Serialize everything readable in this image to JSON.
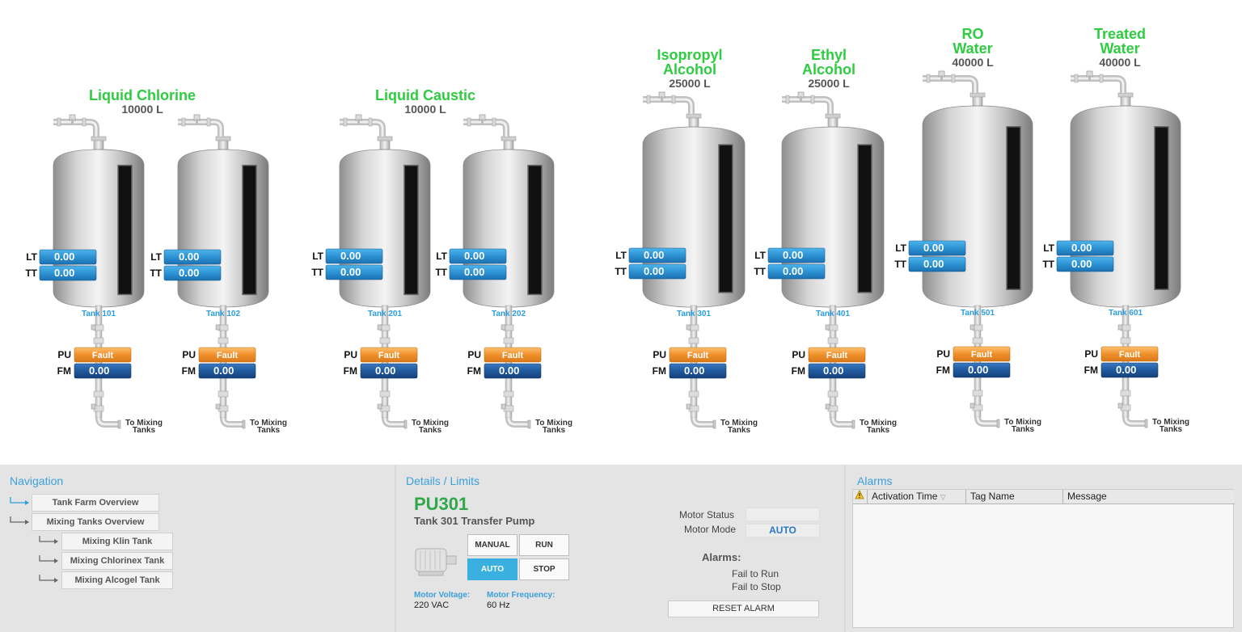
{
  "tank_groups": [
    {
      "name": "Liquid Chlorine",
      "capacity": "10000 L"
    },
    {
      "name": "Liquid Caustic",
      "capacity": "10000 L"
    },
    {
      "name": "Isopropyl Alcohol",
      "capacity": "25000 L"
    },
    {
      "name": "Ethyl Alcohol",
      "capacity": "25000 L"
    },
    {
      "name": "RO Water",
      "capacity": "40000 L"
    },
    {
      "name": "Treated Water",
      "capacity": "40000 L"
    }
  ],
  "tanks": [
    {
      "id": "Tank 101",
      "lt_label": "LT",
      "lt": "0.00",
      "tt_label": "TT",
      "tt": "0.00",
      "pu_label": "PU",
      "pu": "Fault",
      "fm_label": "FM",
      "fm": "0.00",
      "dest": "To Mixing Tanks"
    },
    {
      "id": "Tank 102",
      "lt_label": "LT",
      "lt": "0.00",
      "tt_label": "TT",
      "tt": "0.00",
      "pu_label": "PU",
      "pu": "Fault",
      "fm_label": "FM",
      "fm": "0.00",
      "dest": "To Mixing Tanks"
    },
    {
      "id": "Tank 201",
      "lt_label": "LT",
      "lt": "0.00",
      "tt_label": "TT",
      "tt": "0.00",
      "pu_label": "PU",
      "pu": "Fault",
      "fm_label": "FM",
      "fm": "0.00",
      "dest": "To Mixing Tanks"
    },
    {
      "id": "Tank 202",
      "lt_label": "LT",
      "lt": "0.00",
      "tt_label": "TT",
      "tt": "0.00",
      "pu_label": "PU",
      "pu": "Fault",
      "fm_label": "FM",
      "fm": "0.00",
      "dest": "To Mixing Tanks"
    },
    {
      "id": "Tank 301",
      "lt_label": "LT",
      "lt": "0.00",
      "tt_label": "TT",
      "tt": "0.00",
      "pu_label": "PU",
      "pu": "Fault",
      "fm_label": "FM",
      "fm": "0.00",
      "dest": "To Mixing Tanks"
    },
    {
      "id": "Tank 401",
      "lt_label": "LT",
      "lt": "0.00",
      "tt_label": "TT",
      "tt": "0.00",
      "pu_label": "PU",
      "pu": "Fault",
      "fm_label": "FM",
      "fm": "0.00",
      "dest": "To Mixing Tanks"
    },
    {
      "id": "Tank 501",
      "lt_label": "LT",
      "lt": "0.00",
      "tt_label": "TT",
      "tt": "0.00",
      "pu_label": "PU",
      "pu": "Fault",
      "fm_label": "FM",
      "fm": "0.00",
      "dest": "To Mixing Tanks"
    },
    {
      "id": "Tank 601",
      "lt_label": "LT",
      "lt": "0.00",
      "tt_label": "TT",
      "tt": "0.00",
      "pu_label": "PU",
      "pu": "Fault",
      "fm_label": "FM",
      "fm": "0.00",
      "dest": "To Mixing Tanks"
    }
  ],
  "navigation": {
    "title": "Navigation",
    "items": [
      "Tank Farm Overview",
      "Mixing Tanks Overview",
      "Mixing Klin Tank",
      "Mixing Chlorinex Tank",
      "Mixing Alcogel Tank"
    ]
  },
  "details": {
    "title": "Details / Limits",
    "tag": "PU301",
    "description": "Tank 301 Transfer Pump",
    "buttons": {
      "manual": "MANUAL",
      "run": "RUN",
      "auto": "AUTO",
      "stop": "STOP"
    },
    "motor_voltage_label": "Motor Voltage:",
    "motor_voltage": "220 VAC",
    "motor_frequency_label": "Motor Frequency:",
    "motor_frequency": "60 Hz",
    "motor_status_label": "Motor Status",
    "motor_status": "",
    "motor_mode_label": "Motor Mode",
    "motor_mode": "AUTO",
    "alarms_label": "Alarms:",
    "alarm_1": "Fail to Run",
    "alarm_2": "Fail to Stop",
    "reset_label": "RESET ALARM"
  },
  "alarms": {
    "title": "Alarms",
    "columns": [
      "Activation Time",
      "Tag Name",
      "Message"
    ]
  },
  "colors": {
    "title_green": "#2ecc40",
    "display_blue": "#2a8fd0",
    "fault_orange": "#f0902a",
    "link_blue": "#2a9ee0"
  }
}
